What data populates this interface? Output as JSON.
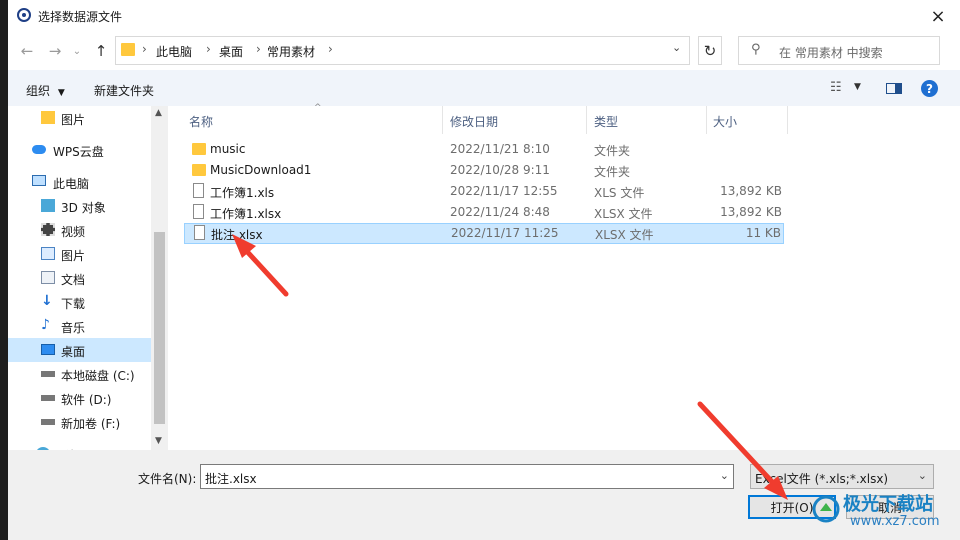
{
  "window": {
    "title": "选择数据源文件",
    "close_icon": "×"
  },
  "address_bar": {
    "breadcrumbs": [
      "此电脑",
      "桌面",
      "常用素材"
    ],
    "search_placeholder": "在 常用素材 中搜索"
  },
  "toolbar": {
    "organize_label": "组织",
    "new_folder_label": "新建文件夹"
  },
  "nav": {
    "items": [
      {
        "label": "图片",
        "icon": "folder-icon"
      },
      {
        "label": "WPS云盘",
        "icon": "cloud-icon"
      },
      {
        "label": "此电脑",
        "icon": "computer-icon"
      },
      {
        "label": "3D 对象",
        "icon": "3d-objects-icon"
      },
      {
        "label": "视频",
        "icon": "video-icon"
      },
      {
        "label": "图片",
        "icon": "pictures-icon"
      },
      {
        "label": "文档",
        "icon": "documents-icon"
      },
      {
        "label": "下载",
        "icon": "download-icon"
      },
      {
        "label": "音乐",
        "icon": "music-icon"
      },
      {
        "label": "桌面",
        "icon": "desktop-icon"
      },
      {
        "label": "本地磁盘 (C:)",
        "icon": "drive-icon"
      },
      {
        "label": "软件 (D:)",
        "icon": "drive-icon"
      },
      {
        "label": "新加卷 (F:)",
        "icon": "drive-icon"
      },
      {
        "label": "网络",
        "icon": "network-icon"
      }
    ],
    "selected": "桌面"
  },
  "columns": {
    "name": "名称",
    "date": "修改日期",
    "type": "类型",
    "size": "大小"
  },
  "files": [
    {
      "name": "music",
      "date": "2022/11/21 8:10",
      "type": "文件夹",
      "size": "",
      "kind": "folder"
    },
    {
      "name": "MusicDownload1",
      "date": "2022/10/28 9:11",
      "type": "文件夹",
      "size": "",
      "kind": "folder"
    },
    {
      "name": "工作簿1.xls",
      "date": "2022/11/17 12:55",
      "type": "XLS 文件",
      "size": "13,892 KB",
      "kind": "file"
    },
    {
      "name": "工作簿1.xlsx",
      "date": "2022/11/24 8:48",
      "type": "XLSX 文件",
      "size": "13,892 KB",
      "kind": "file"
    },
    {
      "name": "批注.xlsx",
      "date": "2022/11/17 11:25",
      "type": "XLSX 文件",
      "size": "11 KB",
      "kind": "file",
      "selected": true
    }
  ],
  "footer": {
    "filename_label": "文件名(N):",
    "filename_value": "批注.xlsx",
    "filter_value": "Excel文件 (*.xls;*.xlsx)",
    "open_label": "打开(O)",
    "cancel_label": "取消"
  },
  "watermark": {
    "text": "极光下载站",
    "url": "www.xz7.com"
  },
  "colors": {
    "selection": "#cce8ff",
    "accent": "#0078d7",
    "arrow": "#f03c2e"
  }
}
